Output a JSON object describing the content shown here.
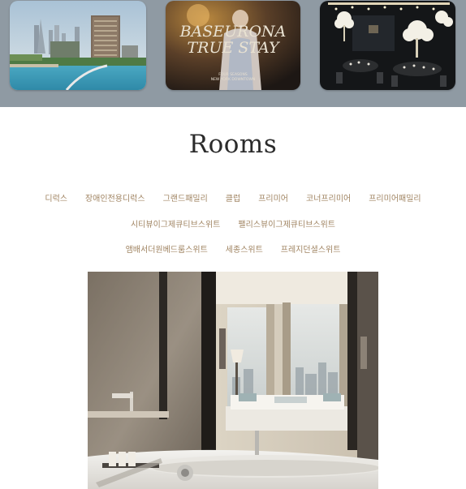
{
  "gallery": {
    "cards": [
      {
        "name": "city-skyline-photo"
      },
      {
        "name": "baseurona-true-stay-photo",
        "title_line1": "BASEURONA",
        "title_line2": "TRUE STAY",
        "subtitle_line1": "FOUR SEASONS",
        "subtitle_line2": "NEW YORK DOWNTOWN"
      },
      {
        "name": "banquet-hall-photo"
      }
    ]
  },
  "main": {
    "title": "Rooms",
    "room_links_rows": [
      [
        "디럭스",
        "장애인전용디럭스",
        "그랜드패밀리",
        "클럽",
        "프리미어",
        "코너프리미어",
        "프리미어패밀리"
      ],
      [
        "시티뷰이그제큐티브스위트",
        "팰리스뷰이그제큐티브스위트"
      ],
      [
        "앰배서더원베드룸스위트",
        "세종스위트",
        "프레지던셜스위트"
      ]
    ]
  },
  "colors": {
    "strip_background": "#8f9aa3",
    "link_color": "#a08462",
    "title_color": "#2b2b2b"
  }
}
